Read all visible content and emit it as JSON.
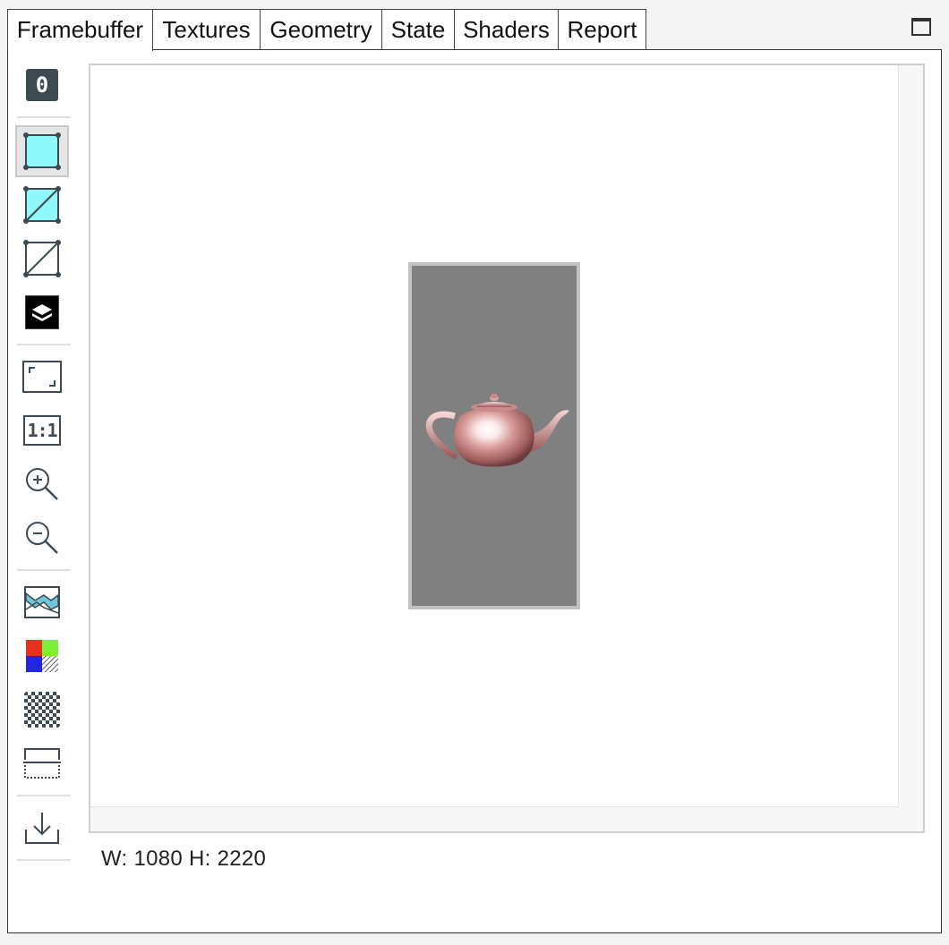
{
  "tabs": [
    {
      "label": "Framebuffer",
      "active": true
    },
    {
      "label": "Textures",
      "active": false
    },
    {
      "label": "Geometry",
      "active": false
    },
    {
      "label": "State",
      "active": false
    },
    {
      "label": "Shaders",
      "active": false
    },
    {
      "label": "Report",
      "active": false
    }
  ],
  "toolbar": {
    "attachment_label": "0",
    "one_to_one_label": "1:1",
    "tools": [
      {
        "name": "attachment-icon"
      },
      {
        "name": "draw-mode-solid-icon",
        "selected": true
      },
      {
        "name": "draw-mode-solid-wire-icon"
      },
      {
        "name": "draw-mode-wireframe-icon"
      },
      {
        "name": "draw-mode-overdraw-icon"
      },
      {
        "name": "fit-to-screen-icon"
      },
      {
        "name": "original-size-icon"
      },
      {
        "name": "zoom-in-icon"
      },
      {
        "name": "zoom-out-icon"
      },
      {
        "name": "histogram-icon"
      },
      {
        "name": "color-channels-icon"
      },
      {
        "name": "transparency-checkerboard-icon"
      },
      {
        "name": "flip-vertical-icon"
      },
      {
        "name": "download-icon"
      }
    ]
  },
  "colors": {
    "framebuffer_bg": "#808080",
    "teapot": "#c98a8a",
    "accent_cyan": "#8ff8fb"
  },
  "status": {
    "text": "W: 1080 H: 2220"
  }
}
